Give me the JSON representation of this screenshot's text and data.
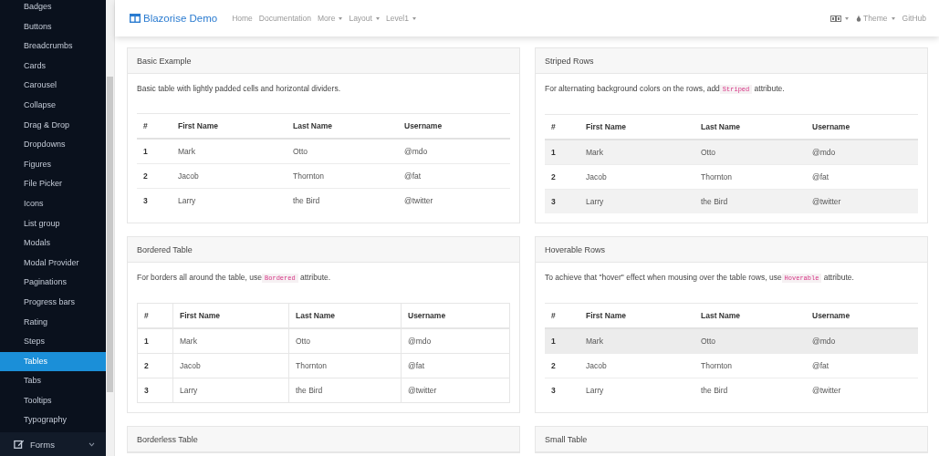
{
  "sidebar": {
    "items": [
      {
        "label": "Badges",
        "selected": false
      },
      {
        "label": "Buttons",
        "selected": false
      },
      {
        "label": "Breadcrumbs",
        "selected": false
      },
      {
        "label": "Cards",
        "selected": false
      },
      {
        "label": "Carousel",
        "selected": false
      },
      {
        "label": "Collapse",
        "selected": false
      },
      {
        "label": "Drag & Drop",
        "selected": false
      },
      {
        "label": "Dropdowns",
        "selected": false
      },
      {
        "label": "Figures",
        "selected": false
      },
      {
        "label": "File Picker",
        "selected": false
      },
      {
        "label": "Icons",
        "selected": false
      },
      {
        "label": "List group",
        "selected": false
      },
      {
        "label": "Modals",
        "selected": false
      },
      {
        "label": "Modal Provider",
        "selected": false
      },
      {
        "label": "Paginations",
        "selected": false
      },
      {
        "label": "Progress bars",
        "selected": false
      },
      {
        "label": "Rating",
        "selected": false
      },
      {
        "label": "Steps",
        "selected": false
      },
      {
        "label": "Tables",
        "selected": true
      },
      {
        "label": "Tabs",
        "selected": false
      },
      {
        "label": "Tooltips",
        "selected": false
      },
      {
        "label": "Typography",
        "selected": false
      }
    ],
    "group": {
      "label": "Forms",
      "expanded": false
    }
  },
  "navbar": {
    "brand": "Blazorise Demo",
    "links": [
      {
        "label": "Home",
        "dropdown": false
      },
      {
        "label": "Documentation",
        "dropdown": false
      },
      {
        "label": "More",
        "dropdown": true
      },
      {
        "label": "Layout",
        "dropdown": true
      },
      {
        "label": "Level1",
        "dropdown": true
      }
    ],
    "right": [
      {
        "kind": "language",
        "dropdown": true
      },
      {
        "kind": "theme",
        "label": "Theme",
        "dropdown": true
      },
      {
        "kind": "link",
        "label": "GitHub",
        "dropdown": false
      }
    ]
  },
  "cards": [
    {
      "title": "Basic Example",
      "kind": "basic",
      "description": {
        "before": "Basic table with lightly padded cells and horizontal dividers."
      },
      "table": {
        "columns": [
          "#",
          "First Name",
          "Last Name",
          "Username"
        ],
        "rows": [
          {
            "cells": [
              "1",
              "Mark",
              "Otto",
              "@mdo"
            ]
          },
          {
            "cells": [
              "2",
              "Jacob",
              "Thornton",
              "@fat"
            ]
          },
          {
            "cells": [
              "3",
              "Larry",
              "the Bird",
              "@twitter"
            ]
          }
        ]
      }
    },
    {
      "title": "Striped Rows",
      "kind": "striped",
      "description": {
        "before": "For alternating background colors on the rows, add",
        "code": "Striped",
        "after": "attribute."
      },
      "table": {
        "columns": [
          "#",
          "First Name",
          "Last Name",
          "Username"
        ],
        "rows": [
          {
            "cells": [
              "1",
              "Mark",
              "Otto",
              "@mdo"
            ]
          },
          {
            "cells": [
              "2",
              "Jacob",
              "Thornton",
              "@fat"
            ]
          },
          {
            "cells": [
              "3",
              "Larry",
              "the Bird",
              "@twitter"
            ]
          }
        ]
      }
    },
    {
      "title": "Bordered Table",
      "kind": "bordered",
      "description": {
        "before": "For borders all around the table, use",
        "code": "Bordered",
        "after": "attribute."
      },
      "table": {
        "columns": [
          "#",
          "First Name",
          "Last Name",
          "Username"
        ],
        "rows": [
          {
            "cells": [
              "1",
              "Mark",
              "Otto",
              "@mdo"
            ]
          },
          {
            "cells": [
              "2",
              "Jacob",
              "Thornton",
              "@fat"
            ]
          },
          {
            "cells": [
              "3",
              "Larry",
              "the Bird",
              "@twitter"
            ]
          }
        ]
      }
    },
    {
      "title": "Hoverable Rows",
      "kind": "hoverable",
      "description": {
        "before": "To achieve that \"hover\" effect when mousing over the table rows, use",
        "code": "Hoverable",
        "after": "attribute."
      },
      "table": {
        "columns": [
          "#",
          "First Name",
          "Last Name",
          "Username"
        ],
        "rows": [
          {
            "cells": [
              "1",
              "Mark",
              "Otto",
              "@mdo"
            ],
            "hovered": true
          },
          {
            "cells": [
              "2",
              "Jacob",
              "Thornton",
              "@fat"
            ],
            "hovered": false
          },
          {
            "cells": [
              "3",
              "Larry",
              "the Bird",
              "@twitter"
            ],
            "hovered": false
          }
        ]
      }
    },
    {
      "title": "Borderless Table",
      "kind": "collapsed"
    },
    {
      "title": "Small Table",
      "kind": "collapsed"
    }
  ]
}
